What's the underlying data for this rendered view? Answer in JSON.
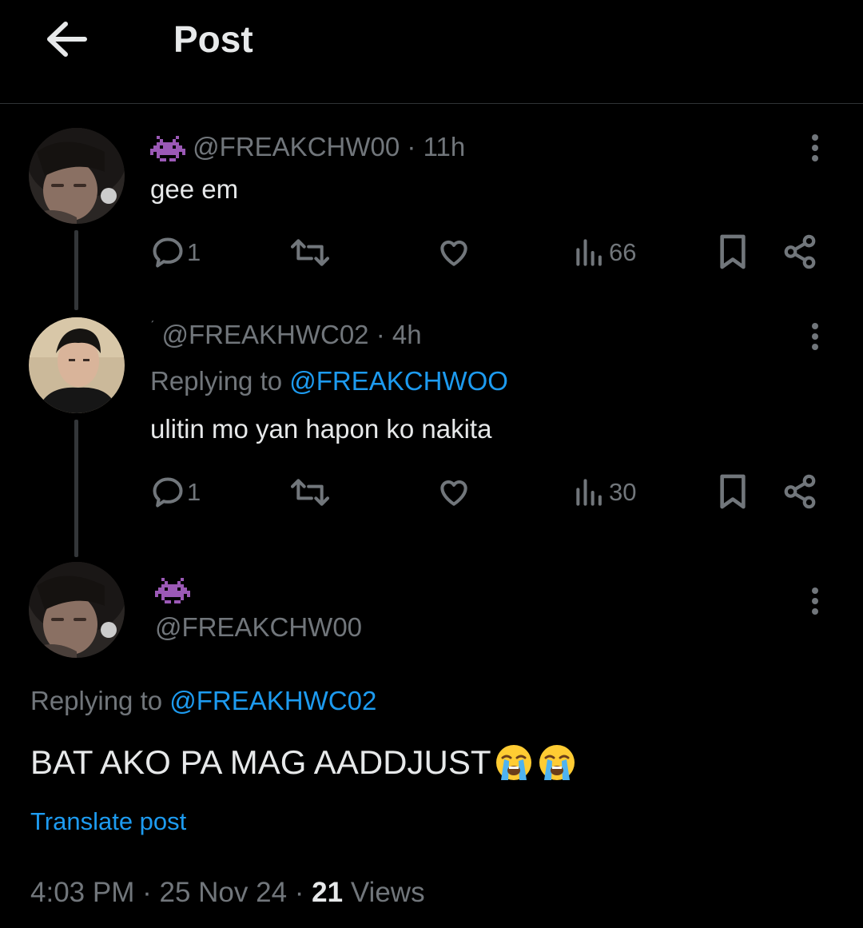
{
  "header": {
    "title": "Post"
  },
  "tweets": [
    {
      "handle": "@FREAKCHW00",
      "time": "11h",
      "text": "gee em",
      "replies": "1",
      "views": "66"
    },
    {
      "handle": "@FREAKHWC02",
      "time": "4h",
      "replying_prefix": "Replying to ",
      "replying_to": "@FREAKCHWOO",
      "text": "ulitin mo yan hapon ko nakita",
      "replies": "1",
      "views": "30"
    }
  ],
  "main": {
    "handle": "@FREAKCHW00",
    "replying_prefix": "Replying to ",
    "replying_to": "@FREAKHWC02",
    "text": "BAT AKO PA MAG AADDJUST",
    "emoji": "loudly-crying-face",
    "translate": "Translate post",
    "time": "4:03 PM",
    "date": "25 Nov 24",
    "views_count": "21",
    "views_label": "Views",
    "separator": "·"
  },
  "colors": {
    "accent": "#1d9bf0",
    "muted": "#71767b",
    "alien": "#9b59b6"
  }
}
